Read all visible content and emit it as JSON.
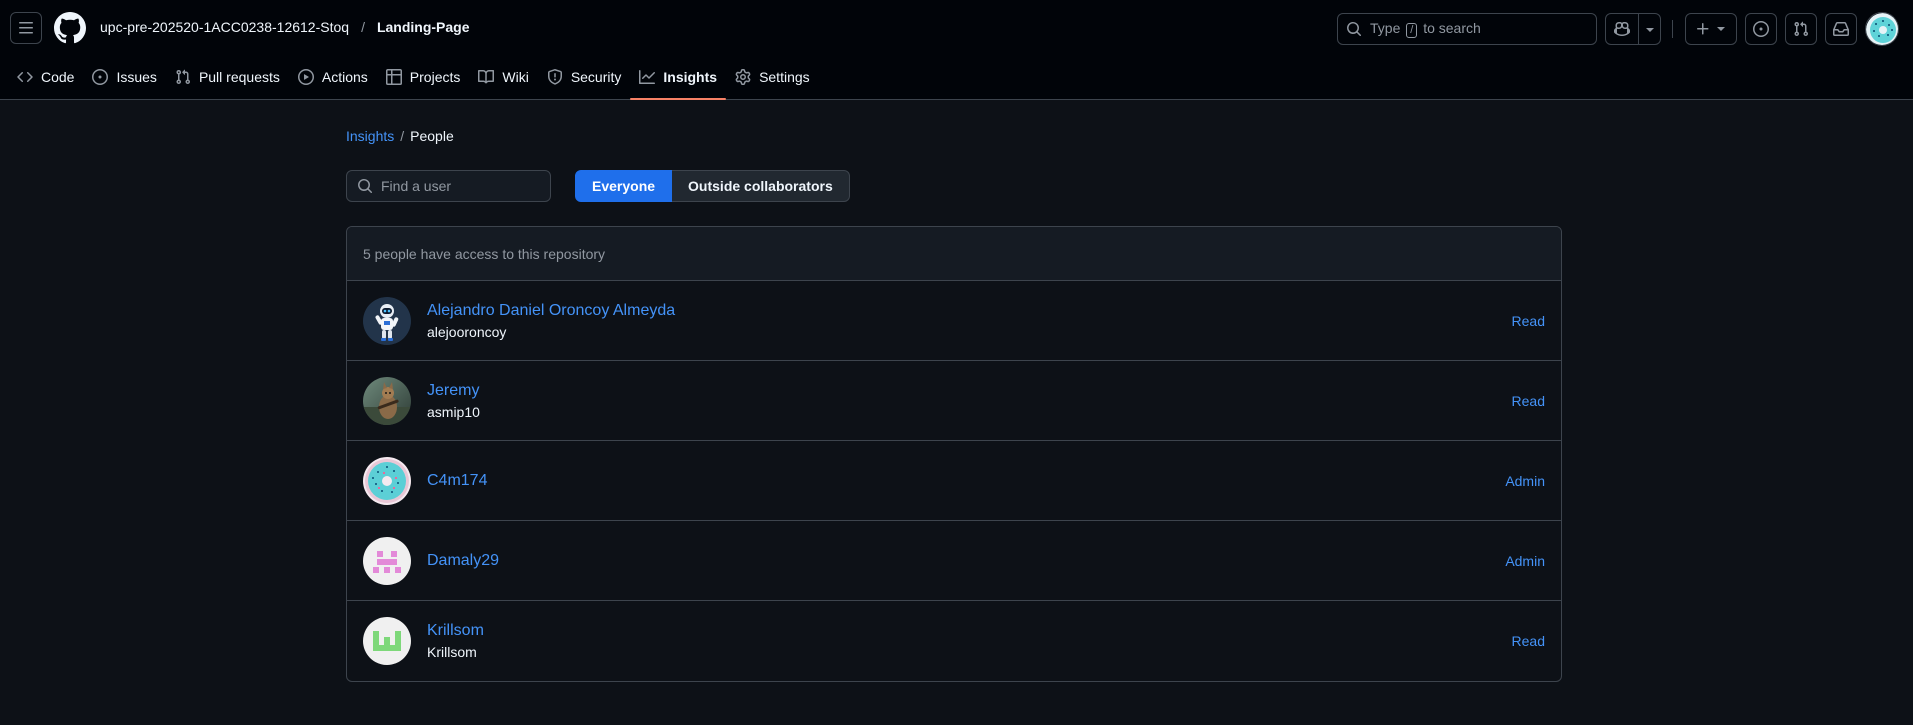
{
  "header": {
    "owner": "upc-pre-202520-1ACC0238-12612-Stoq",
    "separator": "/",
    "repo": "Landing-Page",
    "search": {
      "prefix": "Type",
      "key": "/",
      "suffix": "to search"
    }
  },
  "nav": {
    "items": [
      {
        "label": "Code",
        "icon": "code-icon"
      },
      {
        "label": "Issues",
        "icon": "issue-icon"
      },
      {
        "label": "Pull requests",
        "icon": "pull-request-icon"
      },
      {
        "label": "Actions",
        "icon": "play-icon"
      },
      {
        "label": "Projects",
        "icon": "table-icon"
      },
      {
        "label": "Wiki",
        "icon": "book-icon"
      },
      {
        "label": "Security",
        "icon": "shield-icon"
      },
      {
        "label": "Insights",
        "icon": "graph-icon",
        "active": true
      },
      {
        "label": "Settings",
        "icon": "gear-icon"
      }
    ]
  },
  "breadcrumb": {
    "parent": "Insights",
    "separator": "/",
    "current": "People"
  },
  "filter": {
    "placeholder": "Find a user",
    "segments": [
      "Everyone",
      "Outside collaborators"
    ],
    "selected": "Everyone"
  },
  "people": {
    "summary": "5 people have access to this repository",
    "rows": [
      {
        "name": "Alejandro Daniel Oroncoy Almeyda",
        "login": "alejooroncoy",
        "role": "Read",
        "avatar": "astronaut-avatar"
      },
      {
        "name": "Jeremy",
        "login": "asmip10",
        "role": "Read",
        "avatar": "photo-avatar"
      },
      {
        "name": "C4m174",
        "login": "",
        "role": "Admin",
        "avatar": "donut-avatar"
      },
      {
        "name": "Damaly29",
        "login": "",
        "role": "Admin",
        "avatar": "identicon-pink-avatar"
      },
      {
        "name": "Krillsom",
        "login": "Krillsom",
        "role": "Read",
        "avatar": "identicon-green-avatar"
      }
    ]
  },
  "colors": {
    "background": "#0d1117",
    "header_bg": "#010409",
    "link": "#4493f8",
    "accent_primary": "#1f6feb",
    "nav_underline": "#f78166",
    "border": "#3d444d"
  }
}
